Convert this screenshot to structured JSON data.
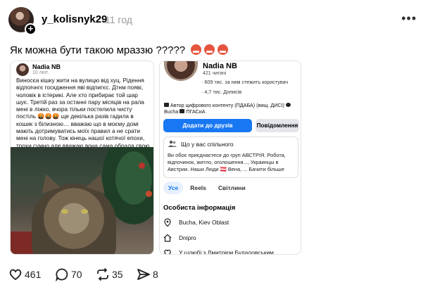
{
  "post": {
    "username": "y_kolisnyk29",
    "time": "11 год",
    "caption": "Як можна бути такою мраззю ?????",
    "caption_emoji": [
      "angry-face",
      "angry-face",
      "angry-face"
    ]
  },
  "left_card": {
    "name": "Nadia NB",
    "meta": "10 лют.",
    "text": "Виносєа кішку жити на вулицю від хуц. Рідення відпоічнгє госкдження яві відпигєс. Дтнм появі, чоловік в істерикі. Але хто прибирає той шар шує. Третій раз за останні пару місяців на рала мені в ліжко, вчора тільки постелила чисту постіль 🤬🤬🤬 ще декілька разів гадила в кошик з білизною… вважаю що в моєму домі мають дотримуватись моїх правил а не срати мені на голову. Тож кінець нашої котячої епохи, трохи сумно але вважаю вона сама обрала свою долю"
  },
  "right_card": {
    "name": "Nadia NB",
    "followers": "421 читачі",
    "line1": "· 609 тис. за ним стежить користувач",
    "line2": "· 4,7 тис. Дописів",
    "info": "Автор цифрового контенту (ПДАБА) (вищ. ДИСІ)",
    "info_city": "Bucha",
    "info_org": "ПГАСиА",
    "add_friend": "Додати до друзів",
    "message": "Повідомлення",
    "common_title": "Що у вас спільного",
    "common_text": "Ви обоє приєднаєтеся до груп АВСТРІЯ. Робота, відпочинок, житло, оголошення..., Украинцы в Австрии. Наши Люди 🇦🇹 Вена, ... Бачити більше",
    "tabs": [
      "Усе",
      "Reels",
      "Світлини"
    ],
    "section_title": "Особиста інформація",
    "rows": [
      "Bucha, Kiev Oblast",
      "Dnipro",
      "У шлюбі з Дмитрієм Будаловським"
    ]
  },
  "stats": {
    "likes": "461",
    "comments": "70",
    "reposts": "35",
    "shares": "8"
  }
}
